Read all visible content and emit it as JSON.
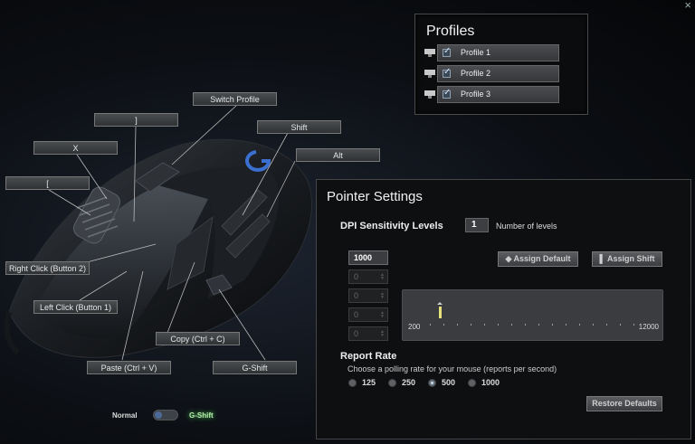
{
  "window": {
    "close_glyph": "×"
  },
  "callouts": {
    "switch_profile": "Switch Profile",
    "bracket_right": "]",
    "shift": "Shift",
    "x": "X",
    "alt": "Alt",
    "bracket_left": "[",
    "right_click": "Right Click (Button 2)",
    "left_click": "Left Click (Button 1)",
    "copy": "Copy (Ctrl + C)",
    "paste": "Paste (Ctrl + V)",
    "gshift": "G-Shift"
  },
  "profiles": {
    "title": "Profiles",
    "items": [
      {
        "label": "Profile 1",
        "checked": true,
        "icon": "monitor-icon"
      },
      {
        "label": "Profile 2",
        "checked": true,
        "icon": "monitor-icon"
      },
      {
        "label": "Profile 3",
        "checked": true,
        "icon": "monitor-icon"
      }
    ]
  },
  "pointer": {
    "title": "Pointer Settings",
    "dpi_label": "DPI Sensitivity Levels",
    "levels_count": "1",
    "levels_label": "Number of levels",
    "dpi_values": [
      "1000",
      "0",
      "0",
      "0",
      "0"
    ],
    "assign_default": "Assign Default",
    "assign_shift": "Assign Shift",
    "slider_min": "200",
    "slider_max": "12000",
    "report_rate_label": "Report Rate",
    "report_rate_desc": "Choose a polling rate for your mouse (reports per second)",
    "rates": [
      "125",
      "250",
      "500",
      "1000"
    ],
    "selected_rate": "500",
    "restore_defaults": "Restore Defaults"
  },
  "mode": {
    "normal": "Normal",
    "gshift": "G-Shift",
    "active": "G-Shift"
  },
  "colors": {
    "accent_blue": "#3b6fd0",
    "gshift_glow": "#b8f0b0",
    "marker": "#e8e07a"
  }
}
